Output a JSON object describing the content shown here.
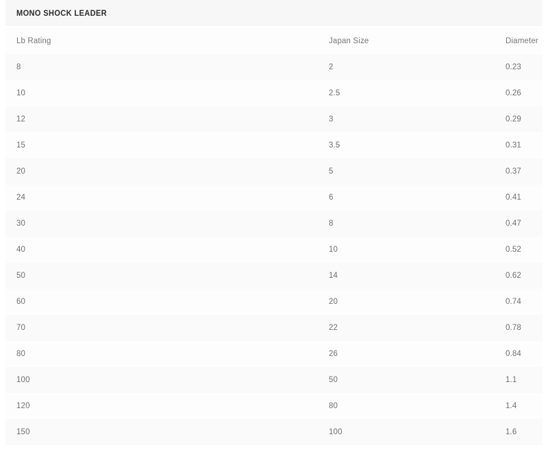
{
  "panel": {
    "title": "MONO SHOCK LEADER"
  },
  "table": {
    "columns": [
      "Lb Rating",
      "Japan Size",
      "Diameter"
    ],
    "rows": [
      [
        "8",
        "2",
        "0.23"
      ],
      [
        "10",
        "2.5",
        "0.26"
      ],
      [
        "12",
        "3",
        "0.29"
      ],
      [
        "15",
        "3.5",
        "0.31"
      ],
      [
        "20",
        "5",
        "0.37"
      ],
      [
        "24",
        "6",
        "0.41"
      ],
      [
        "30",
        "8",
        "0.47"
      ],
      [
        "40",
        "10",
        "0.52"
      ],
      [
        "50",
        "14",
        "0.62"
      ],
      [
        "60",
        "20",
        "0.74"
      ],
      [
        "70",
        "22",
        "0.78"
      ],
      [
        "80",
        "26",
        "0.84"
      ],
      [
        "100",
        "50",
        "1.1"
      ],
      [
        "120",
        "80",
        "1.4"
      ],
      [
        "150",
        "100",
        "1.6"
      ]
    ]
  },
  "colors": {
    "title_band": "#f7f7f7",
    "row_odd": "#fafafa",
    "row_even": "#fdfdfd",
    "title_text": "#2b2b2b",
    "body_text": "#6f6f6f",
    "header_text": "#767676"
  }
}
